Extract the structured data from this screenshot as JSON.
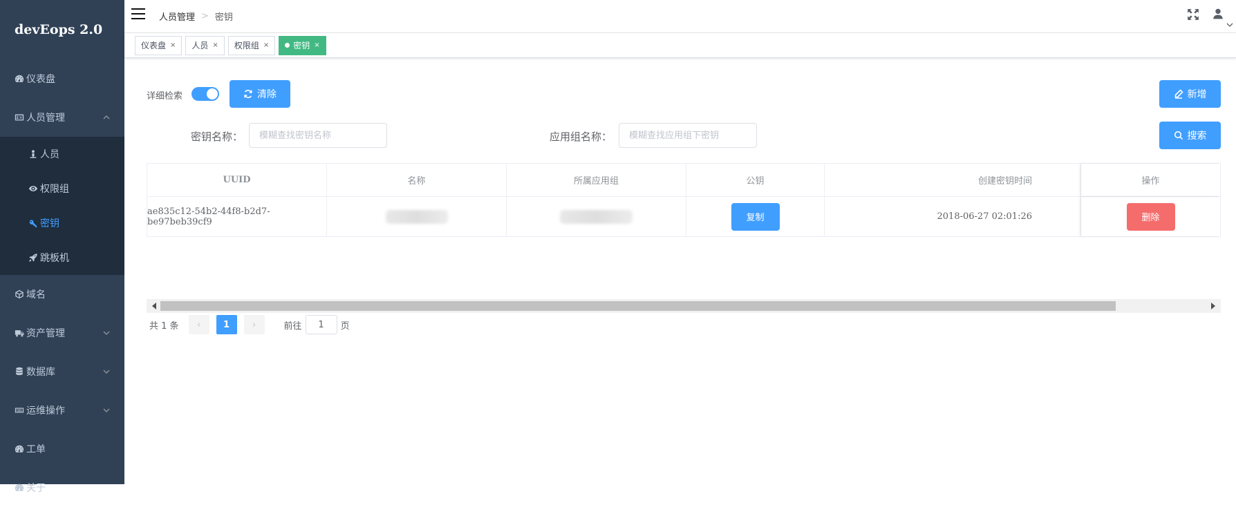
{
  "brand": "devEops 2.0",
  "sidebar": {
    "items": [
      {
        "label": "仪表盘",
        "icon": "dashboard-icon"
      },
      {
        "label": "人员管理",
        "icon": "id-card-icon",
        "expanded": true,
        "children": [
          {
            "label": "人员",
            "icon": "person-icon"
          },
          {
            "label": "权限组",
            "icon": "eye-icon"
          },
          {
            "label": "密钥",
            "icon": "key-icon",
            "active": true
          },
          {
            "label": "跳板机",
            "icon": "rocket-icon"
          }
        ]
      },
      {
        "label": "域名",
        "icon": "cube-icon"
      },
      {
        "label": "资产管理",
        "icon": "truck-icon"
      },
      {
        "label": "数据库",
        "icon": "database-icon"
      },
      {
        "label": "运维操作",
        "icon": "keyboard-icon"
      },
      {
        "label": "工单",
        "icon": "dashboard-icon"
      },
      {
        "label": "关于",
        "icon": "dashboard-icon"
      }
    ]
  },
  "header": {
    "breadcrumb": [
      "人员管理",
      "密钥"
    ],
    "breadcrumb_sep": ">"
  },
  "tags": [
    {
      "label": "仪表盘"
    },
    {
      "label": "人员"
    },
    {
      "label": "权限组"
    },
    {
      "label": "密钥",
      "active": true
    }
  ],
  "tag_close": "×",
  "toolbar": {
    "advanced_label": "详细检索",
    "advanced_on": true,
    "clear_label": "清除",
    "add_label": "新增",
    "search_label": "搜索"
  },
  "filters": {
    "key_name_label": "密钥名称：",
    "key_name_placeholder": "模糊查找密钥名称",
    "group_name_label": "应用组名称：",
    "group_name_placeholder": "模糊查找应用组下密钥"
  },
  "table": {
    "columns": [
      "UUID",
      "名称",
      "所属应用组",
      "公钥",
      "创建密钥时间",
      "操作"
    ],
    "rows": [
      {
        "uuid": "ae835c12-54b2-44f8-b2d7-be97beb39cf9",
        "copy_label": "复制",
        "created": "2018-06-27 02:01:26",
        "delete_label": "删除"
      }
    ]
  },
  "pagination": {
    "total_text": "共 1 条",
    "prev": "‹",
    "current_page": "1",
    "next": "›",
    "goto_label": "前往",
    "goto_value": "1",
    "page_suffix": "页"
  },
  "colors": {
    "sidebar_bg": "#304156",
    "submenu_bg": "#1f2d3d",
    "primary": "#409eff",
    "danger": "#f56c6c",
    "active_tag": "#42b983"
  }
}
